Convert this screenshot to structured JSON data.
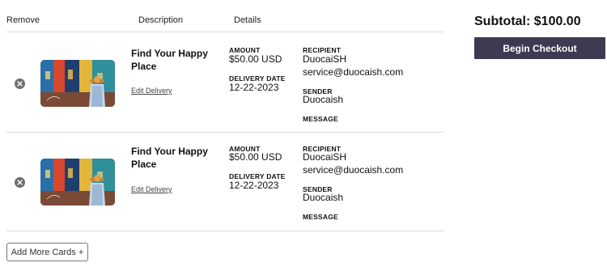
{
  "header": {
    "remove": "Remove",
    "description": "Description",
    "details": "Details"
  },
  "items": [
    {
      "title": "Find Your Happy Place",
      "edit": "Edit Delivery",
      "amount_label": "AMOUNT",
      "amount": "$50.00 USD",
      "delivery_date_label": "DELIVERY DATE",
      "delivery_date": "12-22-2023",
      "recipient_label": "RECIPIENT",
      "recipient_name": "DuocaiSH",
      "recipient_email": "service@duocaish.com",
      "sender_label": "SENDER",
      "sender": "Duocaish",
      "message_label": "MESSAGE"
    },
    {
      "title": "Find Your Happy Place",
      "edit": "Edit Delivery",
      "amount_label": "AMOUNT",
      "amount": "$50.00 USD",
      "delivery_date_label": "DELIVERY DATE",
      "delivery_date": "12-22-2023",
      "recipient_label": "RECIPIENT",
      "recipient_name": "DuocaiSH",
      "recipient_email": "service@duocaish.com",
      "sender_label": "SENDER",
      "sender": "Duocaish",
      "message_label": "MESSAGE"
    }
  ],
  "add_more": "Add More Cards +",
  "summary": {
    "subtotal": "Subtotal: $100.00",
    "checkout": "Begin Checkout"
  },
  "colors": {
    "checkout_bg": "#3d3b52",
    "remove_icon": "#6f6f6f",
    "divider": "#dddddd"
  }
}
